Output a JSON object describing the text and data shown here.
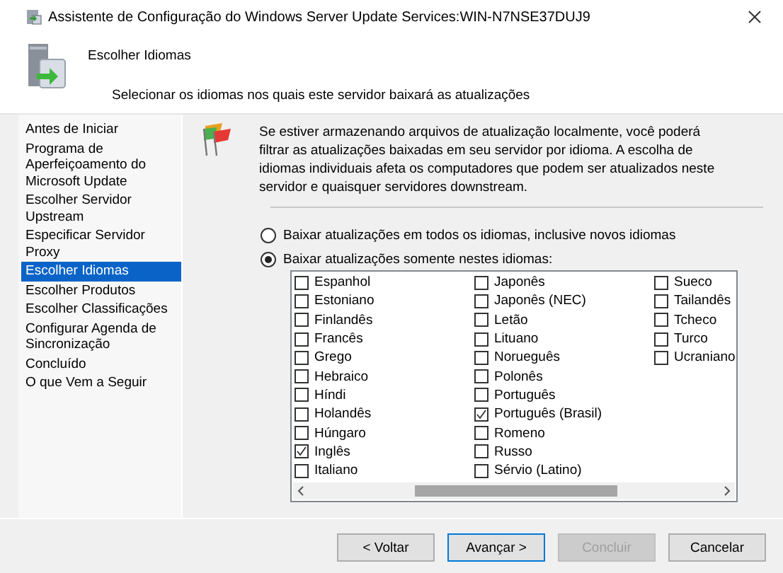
{
  "window": {
    "title": "Assistente de Configuração do Windows Server Update Services:WIN-N7NSE37DUJ9"
  },
  "header": {
    "title": "Escolher Idiomas",
    "subtitle": "Selecionar os idiomas nos quais este servidor baixará as atualizações"
  },
  "sidebar": {
    "items": [
      {
        "label": "Antes de Iniciar",
        "selected": false
      },
      {
        "label": "Programa de Aperfeiçoamento do Microsoft Update",
        "selected": false
      },
      {
        "label": "Escolher Servidor Upstream",
        "selected": false
      },
      {
        "label": "Especificar Servidor Proxy",
        "selected": false
      },
      {
        "label": "Escolher Idiomas",
        "selected": true
      },
      {
        "label": "Escolher Produtos",
        "selected": false
      },
      {
        "label": "Escolher Classificações",
        "selected": false
      },
      {
        "label": "Configurar Agenda de Sincronização",
        "selected": false
      },
      {
        "label": "Concluído",
        "selected": false
      },
      {
        "label": "O que Vem a Seguir",
        "selected": false
      }
    ]
  },
  "description": "Se estiver armazenando arquivos de atualização localmente, você poderá filtrar as atualizações baixadas em seu servidor por idioma. A escolha de idiomas individuais afeta os computadores que podem ser atualizados neste servidor e quaisquer servidores downstream.",
  "options": [
    {
      "label": "Baixar atualizações em todos os idiomas, inclusive novos idiomas",
      "selected": false
    },
    {
      "label": "Baixar atualizações somente nestes idiomas:",
      "selected": true
    }
  ],
  "languages": {
    "columns": [
      [
        {
          "label": "Espanhol",
          "checked": false
        },
        {
          "label": "Estoniano",
          "checked": false
        },
        {
          "label": "Finlandês",
          "checked": false
        },
        {
          "label": "Francês",
          "checked": false
        },
        {
          "label": "Grego",
          "checked": false
        },
        {
          "label": "Hebraico",
          "checked": false
        },
        {
          "label": "Híndi",
          "checked": false
        },
        {
          "label": "Holandês",
          "checked": false
        },
        {
          "label": "Húngaro",
          "checked": false
        },
        {
          "label": "Inglês",
          "checked": true
        },
        {
          "label": "Italiano",
          "checked": false
        }
      ],
      [
        {
          "label": "Japonês",
          "checked": false
        },
        {
          "label": "Japonês (NEC)",
          "checked": false
        },
        {
          "label": "Letão",
          "checked": false
        },
        {
          "label": "Lituano",
          "checked": false
        },
        {
          "label": "Norueguês",
          "checked": false
        },
        {
          "label": "Polonês",
          "checked": false
        },
        {
          "label": "Português",
          "checked": false
        },
        {
          "label": "Português (Brasil)",
          "checked": true
        },
        {
          "label": "Romeno",
          "checked": false
        },
        {
          "label": "Russo",
          "checked": false
        },
        {
          "label": "Sérvio (Latino)",
          "checked": false
        }
      ],
      [
        {
          "label": "Sueco",
          "checked": false
        },
        {
          "label": "Tailandês",
          "checked": false
        },
        {
          "label": "Tcheco",
          "checked": false
        },
        {
          "label": "Turco",
          "checked": false
        },
        {
          "label": "Ucraniano",
          "checked": false
        }
      ]
    ]
  },
  "buttons": [
    {
      "label": "< Voltar",
      "disabled": false,
      "default": false
    },
    {
      "label": "Avançar >",
      "disabled": false,
      "default": true
    },
    {
      "label": "Concluir",
      "disabled": true,
      "default": false
    },
    {
      "label": "Cancelar",
      "disabled": false,
      "default": false
    }
  ]
}
